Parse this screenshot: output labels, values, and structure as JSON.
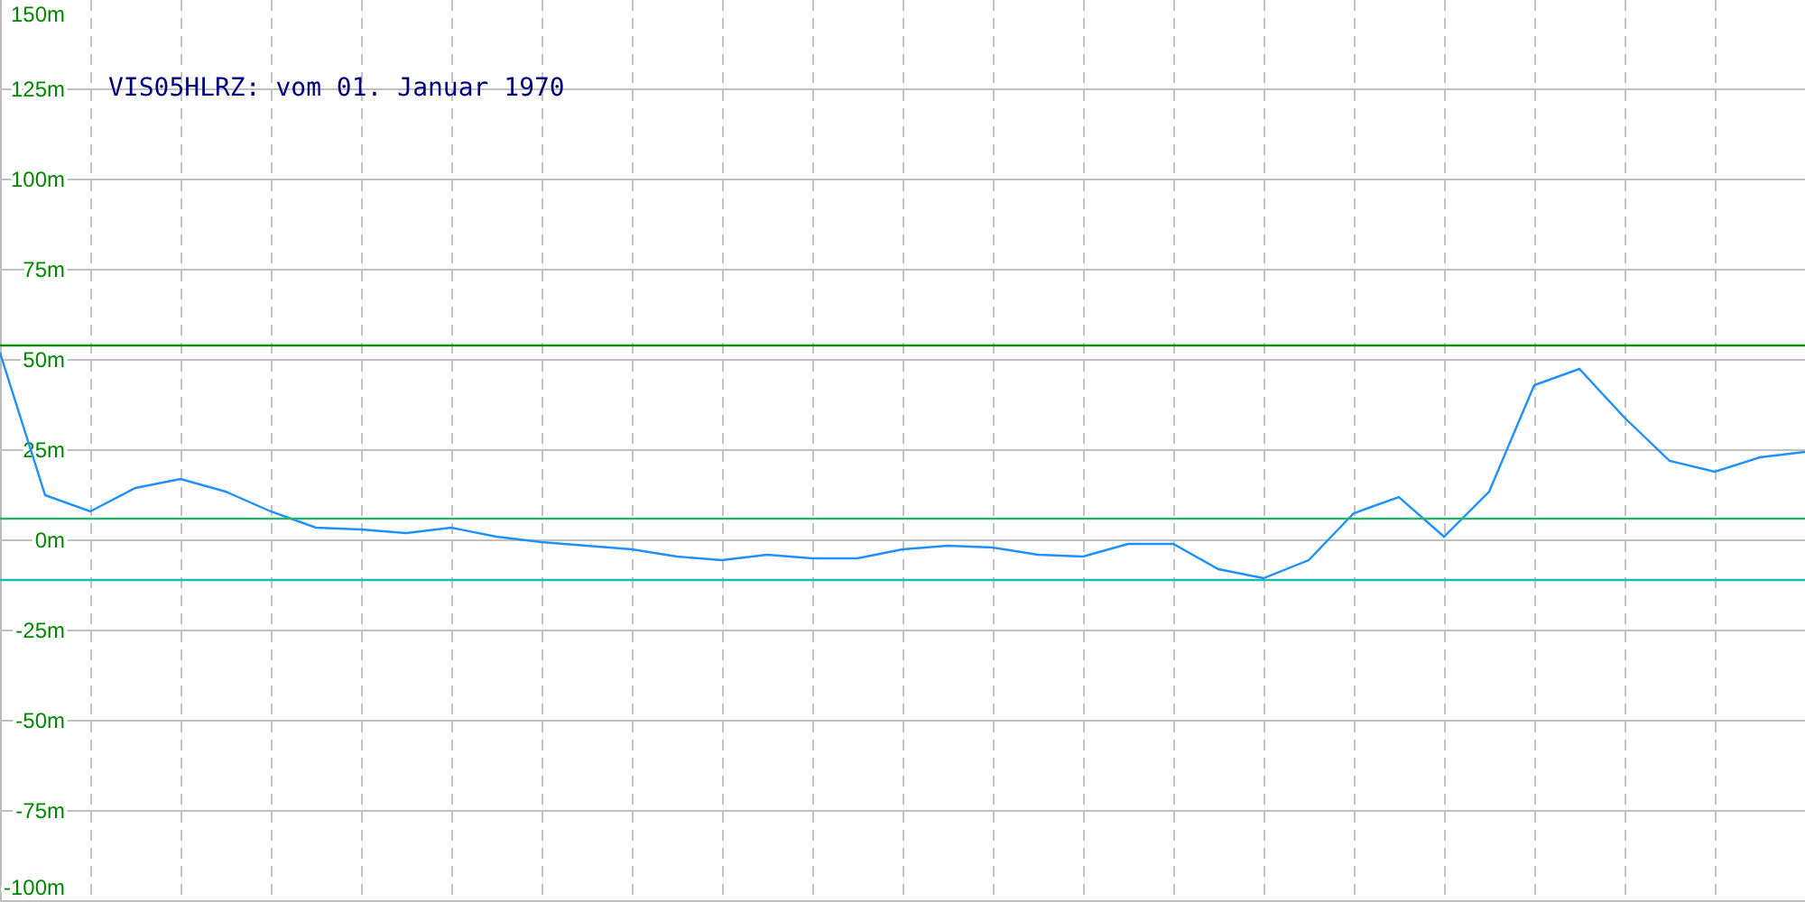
{
  "chart_data": {
    "type": "line",
    "title": "VIS05HLRZ: vom 01. Januar 1970",
    "categories": [
      null,
      null,
      null,
      null,
      null,
      null,
      null,
      null,
      null,
      null,
      null,
      null,
      null,
      null,
      null,
      null,
      null,
      null,
      null,
      null,
      null,
      null,
      null,
      null,
      null,
      null,
      null,
      null,
      null,
      null,
      null,
      null,
      null,
      null,
      null,
      null,
      null,
      null,
      null,
      null,
      null
    ],
    "series": [
      {
        "color": "#1e90ff",
        "values": [
          52,
          12.5,
          8,
          14.5,
          17,
          13.5,
          8,
          3.5,
          3,
          2,
          3.5,
          1,
          -0.5,
          -1.5,
          -2.5,
          -4.5,
          -5.5,
          -4,
          -5,
          -5,
          -2.5,
          -1.5,
          -2,
          -4,
          -4.5,
          -1,
          -1,
          -8,
          -10.5,
          -5.5,
          7.5,
          12,
          1,
          13.5,
          43,
          47.5,
          34,
          22,
          19,
          23,
          24.5
        ]
      },
      {
        "color": "#109010",
        "values": [
          54,
          54,
          54,
          54,
          54,
          54,
          54,
          54,
          54,
          54,
          54,
          54,
          54,
          54,
          54,
          54,
          54,
          54,
          54,
          54,
          54,
          54,
          54,
          54,
          54,
          54,
          54,
          54,
          54,
          54,
          54,
          54,
          54,
          54,
          54,
          54,
          54,
          54,
          54,
          54,
          54
        ]
      },
      {
        "color": "#30b070",
        "values": [
          6,
          6,
          6,
          6,
          6,
          6,
          6,
          6,
          6,
          6,
          6,
          6,
          6,
          6,
          6,
          6,
          6,
          6,
          6,
          6,
          6,
          6,
          6,
          6,
          6,
          6,
          6,
          6,
          6,
          6,
          6,
          6,
          6,
          6,
          6,
          6,
          6,
          6,
          6,
          6,
          6
        ]
      },
      {
        "color": "#20b8b8",
        "values": [
          -11,
          -11,
          -11,
          -11,
          -11,
          -11,
          -11,
          -11,
          -11,
          -11,
          -11,
          -11,
          -11,
          -11,
          -11,
          -11,
          -11,
          -11,
          -11,
          -11,
          -11,
          -11,
          -11,
          -11,
          -11,
          -11,
          -11,
          -11,
          -11,
          -11,
          -11,
          -11,
          -11,
          -11,
          -11,
          -11,
          -11,
          -11,
          -11,
          -11,
          -11
        ]
      }
    ],
    "ylim": [
      -100,
      150
    ],
    "grid": true,
    "yticks": [
      {
        "value": 150,
        "label": "150m"
      },
      {
        "value": 125,
        "label": "125m"
      },
      {
        "value": 100,
        "label": "100m"
      },
      {
        "value": 75,
        "label": "75m"
      },
      {
        "value": 50,
        "label": "50m"
      },
      {
        "value": 25,
        "label": "25m"
      },
      {
        "value": 0,
        "label": "0m"
      },
      {
        "value": -25,
        "label": "-25m"
      },
      {
        "value": -50,
        "label": "-50m"
      },
      {
        "value": -75,
        "label": "-75m"
      },
      {
        "value": -100,
        "label": "-100m"
      }
    ]
  }
}
